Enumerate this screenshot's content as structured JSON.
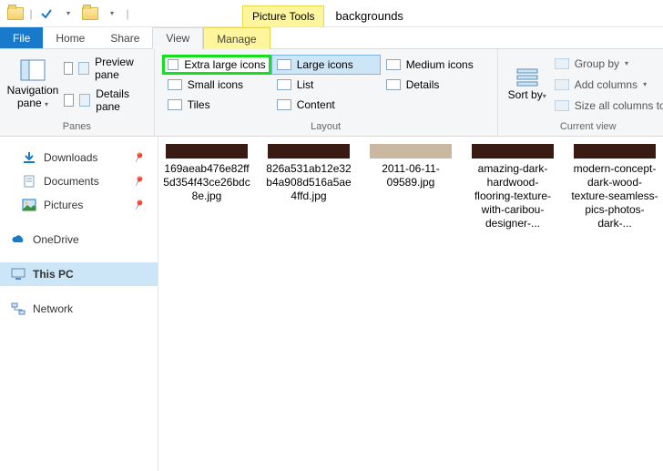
{
  "window": {
    "title": "backgrounds",
    "context_tab": "Picture Tools"
  },
  "tabs": {
    "file": "File",
    "home": "Home",
    "share": "Share",
    "view": "View",
    "manage": "Manage"
  },
  "panes": {
    "nav_label": "Navigation pane",
    "preview": "Preview pane",
    "details": "Details pane",
    "group": "Panes"
  },
  "layout": {
    "group": "Layout",
    "extra_large": "Extra large icons",
    "large": "Large icons",
    "medium": "Medium icons",
    "small": "Small icons",
    "list": "List",
    "details": "Details",
    "tiles": "Tiles",
    "content": "Content"
  },
  "currentview": {
    "group": "Current view",
    "sort": "Sort by",
    "groupby": "Group by",
    "addcols": "Add columns",
    "sizeall": "Size all columns to"
  },
  "nav": {
    "downloads": "Downloads",
    "documents": "Documents",
    "pictures": "Pictures",
    "onedrive": "OneDrive",
    "thispc": "This PC",
    "network": "Network"
  },
  "files": [
    {
      "name": "169aeab476e82ff5d354f43ce26bdc8e.jpg",
      "thumb": "dark"
    },
    {
      "name": "826a531ab12e32b4a908d516a5ae4ffd.jpg",
      "thumb": "dark"
    },
    {
      "name": "2011-06-11-09589.jpg",
      "thumb": "light"
    },
    {
      "name": "amazing-dark-hardwood-flooring-texture-with-caribou-designer-...",
      "thumb": "dark"
    },
    {
      "name": "modern-concept-dark-wood-texture-seamless-pics-photos-dark-...",
      "thumb": "dark"
    }
  ]
}
